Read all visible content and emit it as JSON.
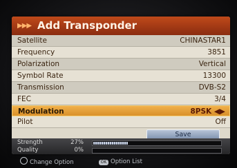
{
  "header": {
    "title": "Add Transponder",
    "arrows": "▶▶▶"
  },
  "rows": [
    {
      "label": "Satellite",
      "value": "CHINASTAR1"
    },
    {
      "label": "Frequency",
      "value": "3851"
    },
    {
      "label": "Polarization",
      "value": "Vertical"
    },
    {
      "label": "Symbol Rate",
      "value": "13300"
    },
    {
      "label": "Transmission",
      "value": "DVB-S2"
    },
    {
      "label": "FEC",
      "value": "3/4"
    },
    {
      "label": "Modulation",
      "value": "8PSK ◀▶"
    },
    {
      "label": "Pilot",
      "value": "Off"
    }
  ],
  "save_label": "Save",
  "signal": {
    "strength_label": "Strength",
    "strength_pct": "27%",
    "strength_fraction": 0.27,
    "quality_label": "Quality",
    "quality_pct": "0%",
    "quality_fraction": 0.0
  },
  "footer": {
    "change_label": "Change Option",
    "list_icon_text": "OK",
    "list_label": "Option List"
  },
  "colors": {
    "header": "#a83a14",
    "highlight": "#e8a23c",
    "panel": "#cfcbbf"
  }
}
